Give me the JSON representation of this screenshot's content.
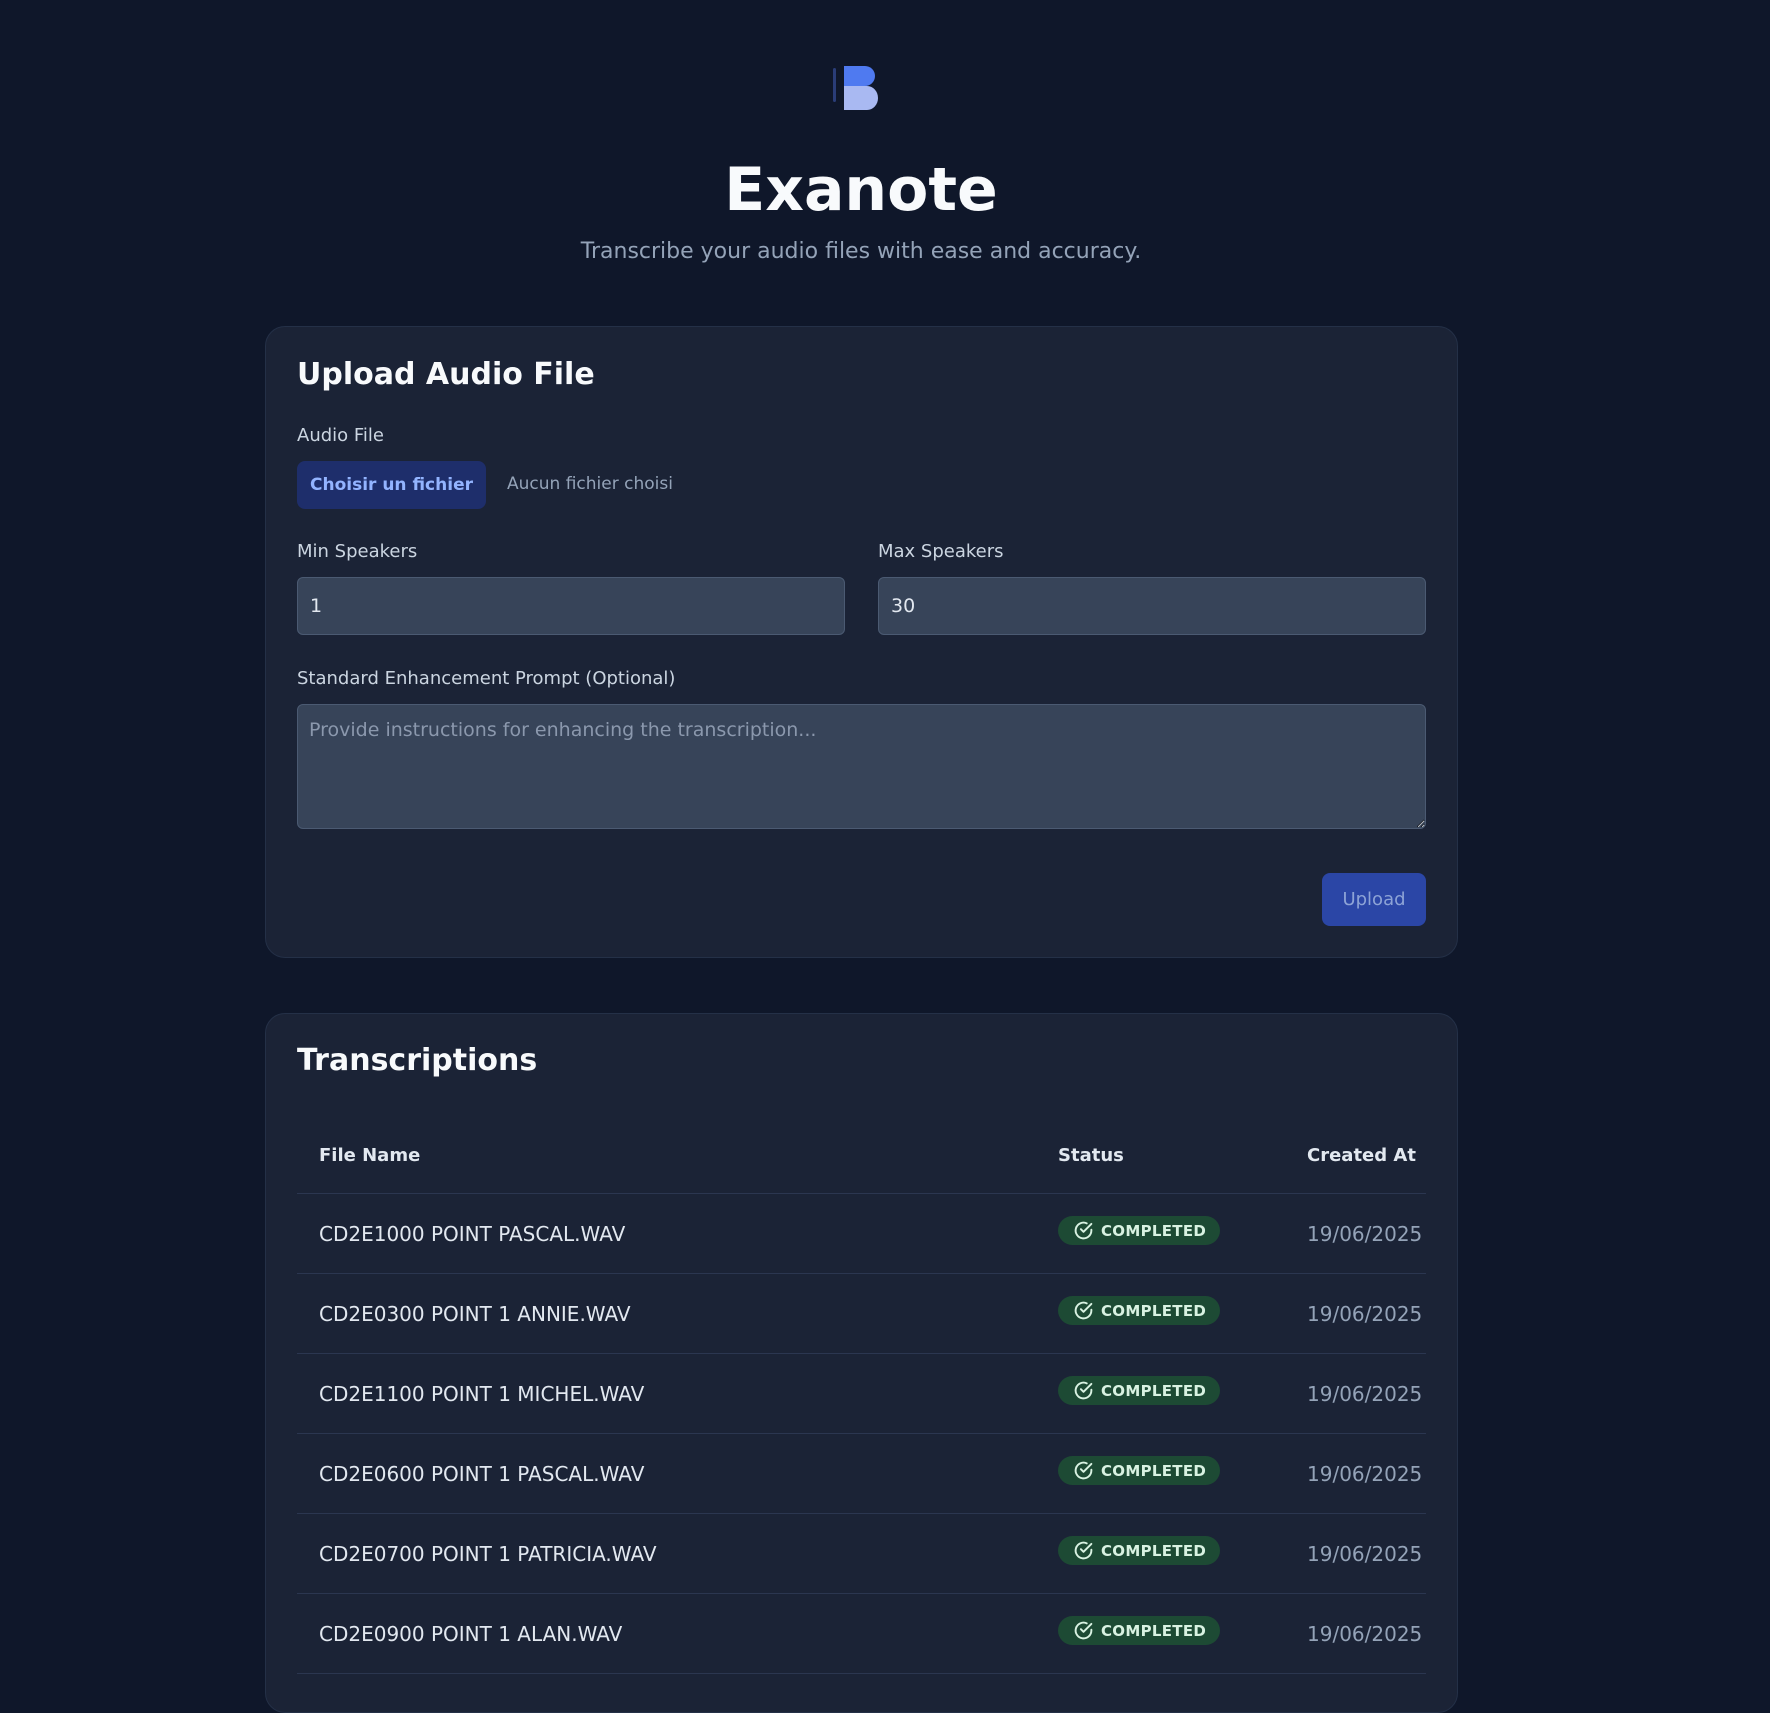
{
  "app": {
    "title": "Exanote",
    "subtitle": "Transcribe your audio files with ease and accuracy."
  },
  "colors": {
    "background": "#0f172a",
    "card": "#1b2336",
    "accent": "#4f6ef7",
    "success_badge": "#1d4a34"
  },
  "upload": {
    "title": "Upload Audio File",
    "audio_label": "Audio File",
    "choose_file_label": "Choisir un fichier",
    "no_file_text": "Aucun fichier choisi",
    "min_speakers_label": "Min Speakers",
    "min_speakers_value": "1",
    "max_speakers_label": "Max Speakers",
    "max_speakers_value": "30",
    "prompt_label": "Standard Enhancement Prompt (Optional)",
    "prompt_placeholder": "Provide instructions for enhancing the transcription...",
    "upload_button_label": "Upload"
  },
  "transcriptions": {
    "title": "Transcriptions",
    "columns": {
      "file_name": "File Name",
      "status": "Status",
      "created_at": "Created At"
    },
    "status_icon": "check-circle-icon",
    "rows": [
      {
        "file_name": "CD2E1000 POINT PASCAL.WAV",
        "status": "COMPLETED",
        "created_at": "19/06/2025"
      },
      {
        "file_name": "CD2E0300 POINT 1 ANNIE.WAV",
        "status": "COMPLETED",
        "created_at": "19/06/2025"
      },
      {
        "file_name": "CD2E1100 POINT 1 MICHEL.WAV",
        "status": "COMPLETED",
        "created_at": "19/06/2025"
      },
      {
        "file_name": "CD2E0600 POINT 1 PASCAL.WAV",
        "status": "COMPLETED",
        "created_at": "19/06/2025"
      },
      {
        "file_name": "CD2E0700 POINT 1 PATRICIA.WAV",
        "status": "COMPLETED",
        "created_at": "19/06/2025"
      },
      {
        "file_name": "CD2E0900 POINT 1 ALAN.WAV",
        "status": "COMPLETED",
        "created_at": "19/06/2025"
      }
    ]
  }
}
